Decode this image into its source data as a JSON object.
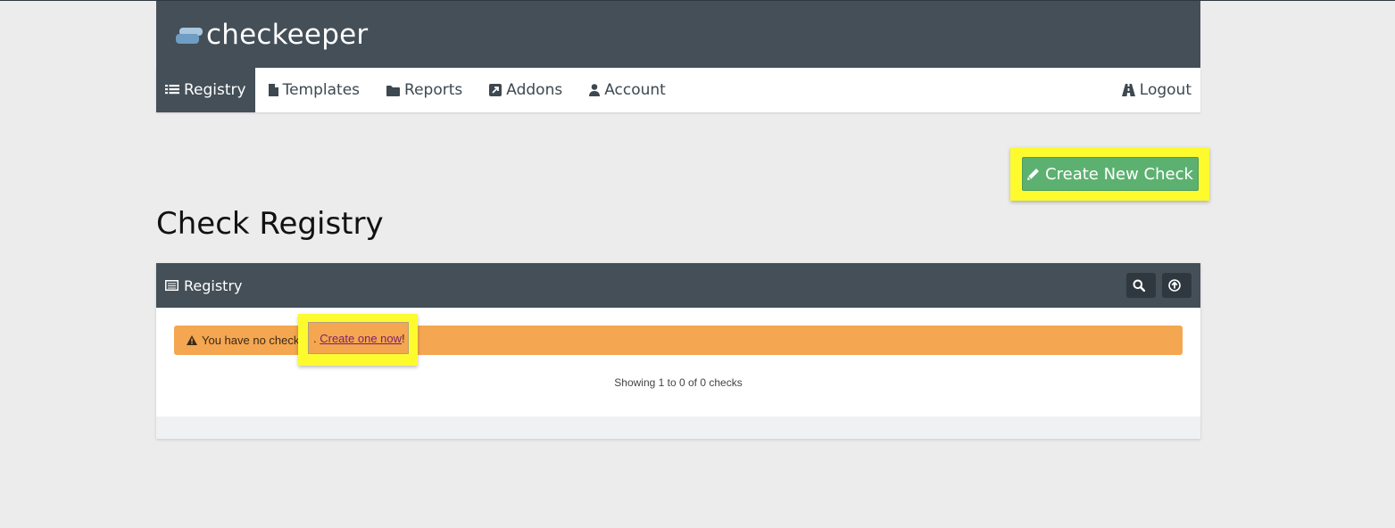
{
  "brand": {
    "name": "checkeeper"
  },
  "nav": {
    "items": [
      {
        "label": "Registry",
        "icon": "list-icon",
        "active": true
      },
      {
        "label": "Templates",
        "icon": "file-icon"
      },
      {
        "label": "Reports",
        "icon": "folder-icon"
      },
      {
        "label": "Addons",
        "icon": "external-link-icon"
      },
      {
        "label": "Account",
        "icon": "user-icon"
      }
    ],
    "logout": {
      "label": "Logout",
      "icon": "road-icon"
    }
  },
  "actions": {
    "create_check_label": "Create New Check",
    "icon": "pencil-icon"
  },
  "page": {
    "title": "Check Registry"
  },
  "panel": {
    "title": "Registry",
    "icon": "table-icon",
    "tools": [
      "search-icon",
      "upload-icon"
    ],
    "alert": {
      "prefix": "You have no check",
      "separator": ". ",
      "link_text": "Create one now",
      "suffix": "!",
      "icon": "warning-icon"
    },
    "showing_text": "Showing 1 to 0 of 0 checks"
  },
  "colors": {
    "header_bg": "#444f58",
    "button_green": "#5cb170",
    "alert_orange": "#f5a650",
    "highlight_yellow": "#fdfb2e"
  }
}
